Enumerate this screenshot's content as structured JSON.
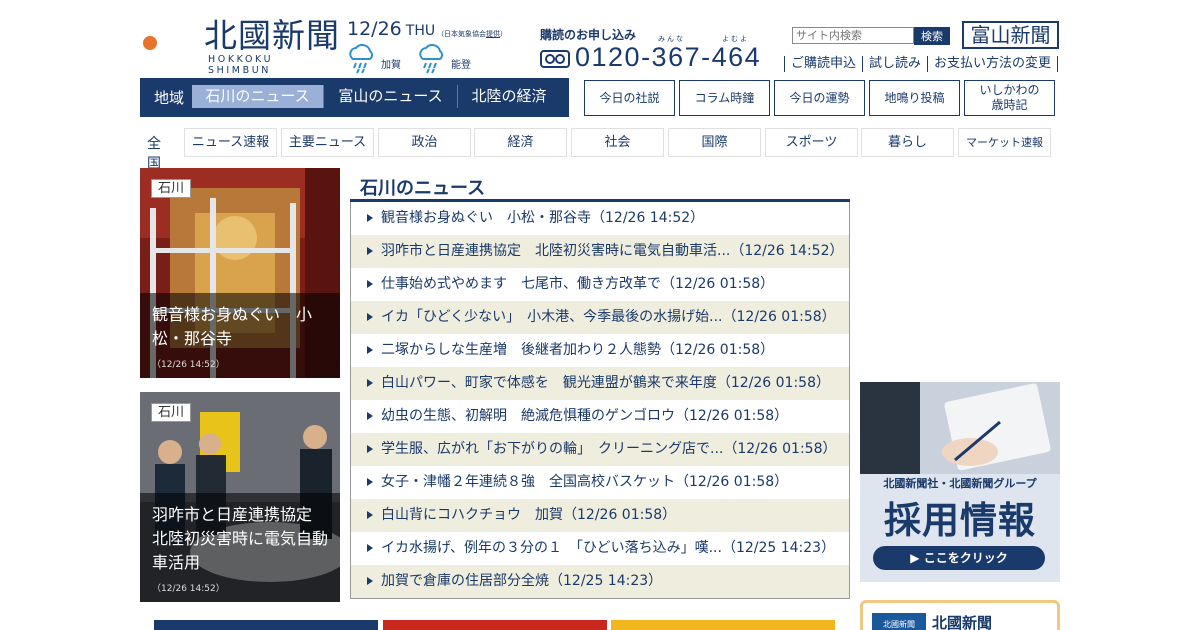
{
  "header": {
    "logo_main": "北國新聞",
    "logo_sub": "HOKKOKU SHIMBUN",
    "date": "12/26",
    "day_of_week": "THU",
    "weather_note_prefix": "（日本気象協会",
    "weather_note_link": "提供",
    "weather_note_suffix": "）",
    "weather": [
      {
        "label": "加賀",
        "icon": "rain-cloud-icon"
      },
      {
        "label": "能登",
        "icon": "rain-cloud-icon"
      }
    ],
    "subscribe_title": "購読のお申し込み",
    "subscribe_ruby_1": "みんな",
    "subscribe_ruby_2": "よむよ",
    "phone": "0120-367-464",
    "search_placeholder": "サイト内検索",
    "search_button": "検索",
    "toyama_button": "富山新聞",
    "sublinks": [
      "ご購読申込",
      "試し読み",
      "お支払い方法の変更"
    ]
  },
  "region_nav": {
    "label": "地域",
    "tabs": [
      {
        "label": "石川のニュース",
        "active": true
      },
      {
        "label": "富山のニュース",
        "active": false
      },
      {
        "label": "北陸の経済",
        "active": false
      }
    ]
  },
  "feature_buttons": [
    "今日の社説",
    "コラム時鐘",
    "今日の運勢",
    "地鳴り投稿"
  ],
  "feature_button_two_line": [
    "いしかわの",
    "歳時記"
  ],
  "genre_nav": {
    "all_label": "全国",
    "items": [
      "ニュース速報",
      "主要ニュース",
      "政治",
      "経済",
      "社会",
      "国際",
      "スポーツ",
      "暮らし",
      "マーケット速報"
    ]
  },
  "photo_cards": [
    {
      "tag": "石川",
      "title": "観音様お身ぬぐい　小松・那谷寺",
      "time": "（12/26 14:52）"
    },
    {
      "tag": "石川",
      "title": "羽咋市と日産連携協定　北陸初災害時に電気自動車活用",
      "time": "（12/26 14:52）"
    }
  ],
  "news": {
    "heading": "石川のニュース",
    "items": [
      "観音様お身ぬぐい　小松・那谷寺（12/26 14:52）",
      "羽咋市と日産連携協定　北陸初災害時に電気自動車活...（12/26 14:52）",
      "仕事始め式やめます　七尾市、働き方改革で（12/26 01:58）",
      "イカ「ひどく少ない」　小木港、今季最後の水揚げ始...（12/26 01:58）",
      "二塚からしな生産増　後継者加わり２人態勢（12/26 01:58）",
      "白山パワー、町家で体感を　観光連盟が鶴来で来年度（12/26 01:58）",
      "幼虫の生態、初解明　絶滅危惧種のゲンゴロウ（12/26 01:58）",
      "学生服、広がれ「お下がりの輪」　クリーニング店で...（12/26 01:58）",
      "女子・津幡２年連続８強　全国高校バスケット（12/26 01:58）",
      "白山背にコハクチョウ　加賀（12/26 01:58）",
      "イカ水揚げ、例年の３分の１　「ひどい落ち込み」嘆...（12/25 14:23）",
      "加賀で倉庫の住居部分全焼（12/25 14:23）"
    ]
  },
  "ad": {
    "subtitle": "北國新聞社・北國新聞グループ",
    "title": "採用情報",
    "button": "▶ ここをクリック"
  },
  "bottom_box": {
    "logo": "北國新聞",
    "text": "北國新聞"
  },
  "colors": {
    "brand_navy": "#1a3a6b",
    "active_tab": "#9ab0d6",
    "alt_row": "#efeddd",
    "orange_mark": "#e8732a"
  }
}
